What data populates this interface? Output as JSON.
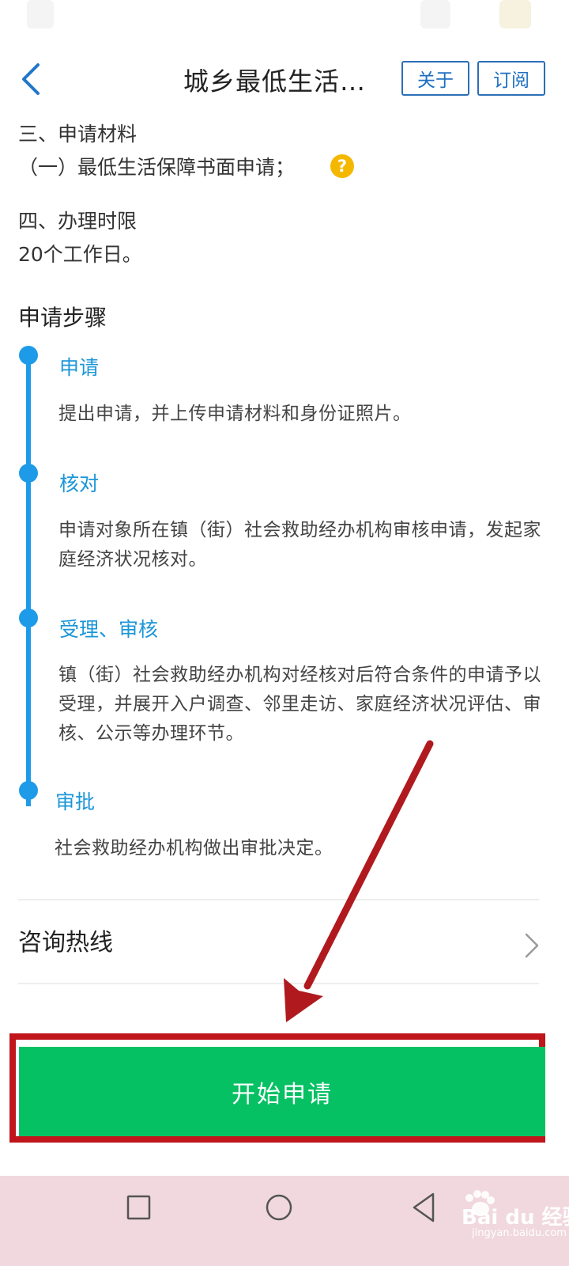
{
  "header": {
    "title": "城乡最低生活…",
    "about_label": "关于",
    "subscribe_label": "订阅"
  },
  "materials": {
    "heading": "三、申请材料",
    "item_1": "（一）最低生活保障书面申请；",
    "help_glyph": "?"
  },
  "time_limit": {
    "heading": "四、办理时限",
    "value": "20个工作日。"
  },
  "steps_section": {
    "title": "申请步骤",
    "steps": [
      {
        "title": "申请",
        "desc": "提出申请，并上传申请材料和身份证照片。"
      },
      {
        "title": "核对",
        "desc": "申请对象所在镇（街）社会救助经办机构审核申请，发起家庭经济状况核对。"
      },
      {
        "title": "受理、审核",
        "desc": "镇（街）社会救助经办机构对经核对后符合条件的申请予以受理，并展开入户调查、邻里走访、家庭经济状况评估、审核、公示等办理环节。"
      },
      {
        "title": "审批",
        "desc": "社会救助经办机构做出审批决定。"
      }
    ]
  },
  "hotline": {
    "label": "咨询热线"
  },
  "primary_action": {
    "label": "开始申请"
  },
  "colors": {
    "accent_blue": "#1e9be8",
    "button_green": "#05c163",
    "highlight_red": "#c0151b",
    "help_yellow": "#f5b800"
  },
  "watermark": {
    "brand": "Bai du 经验",
    "url": "jingyan.baidu.com"
  }
}
